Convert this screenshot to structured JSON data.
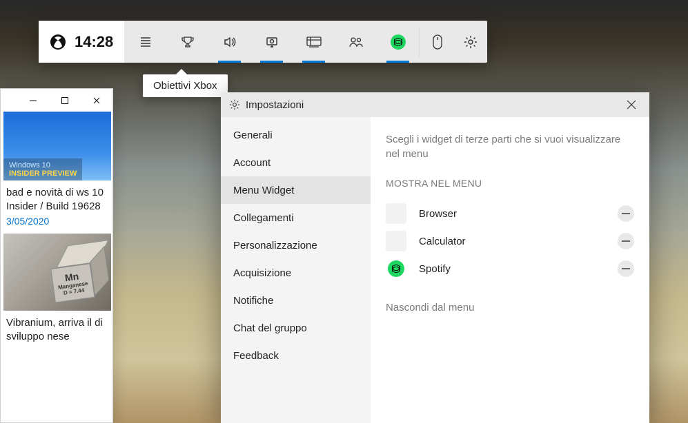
{
  "gamebar": {
    "time": "14:28",
    "items": [
      {
        "name": "list-icon",
        "active": false
      },
      {
        "name": "trophy-icon",
        "active": false
      },
      {
        "name": "audio-icon",
        "active": true
      },
      {
        "name": "capture-icon",
        "active": true
      },
      {
        "name": "performance-icon",
        "active": true
      },
      {
        "name": "social-icon",
        "active": false
      },
      {
        "name": "spotify-icon",
        "active": true
      }
    ],
    "rightItems": [
      {
        "name": "mouse-icon"
      },
      {
        "name": "gear-icon"
      }
    ],
    "tooltip": "Obiettivi Xbox"
  },
  "settings": {
    "title": "Impostazioni",
    "nav": [
      {
        "label": "Generali",
        "selected": false
      },
      {
        "label": "Account",
        "selected": false
      },
      {
        "label": "Menu Widget",
        "selected": true
      },
      {
        "label": "Collegamenti",
        "selected": false
      },
      {
        "label": "Personalizzazione",
        "selected": false
      },
      {
        "label": "Acquisizione",
        "selected": false
      },
      {
        "label": "Notifiche",
        "selected": false
      },
      {
        "label": "Chat del gruppo",
        "selected": false
      },
      {
        "label": "Feedback",
        "selected": false
      }
    ],
    "description": "Scegli i widget di terze parti che si vuoi visualizzare nel menu",
    "sectionTitle": "MOSTRA NEL MENU",
    "widgets": [
      {
        "name": "Browser",
        "icon": "browser"
      },
      {
        "name": "Calculator",
        "icon": "calculator"
      },
      {
        "name": "Spotify",
        "icon": "spotify"
      }
    ],
    "hideSectionTitle": "Nascondi dal menu"
  },
  "backWindow": {
    "thumb1": {
      "line1": "Windows 10",
      "line2": "INSIDER PREVIEW"
    },
    "article1": {
      "title": "bad e novità di ws 10 Insider / Build 19628",
      "date": "3/05/2020"
    },
    "cube": {
      "sym": "Mn",
      "elem": "Manganese",
      "dens": "D = 7.44"
    },
    "article2": {
      "title": "Vibranium, arriva il di sviluppo nese"
    }
  }
}
